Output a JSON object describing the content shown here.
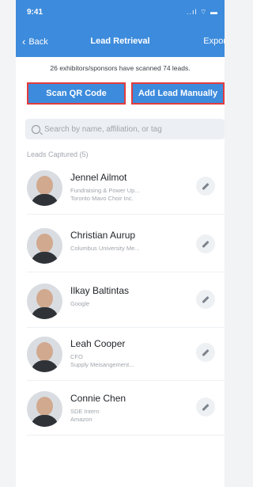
{
  "status": {
    "time": "9:41",
    "icons": "..ıl ⌔ ▬"
  },
  "header": {
    "back_label": "Back",
    "title": "Lead Retrieval",
    "export_label": "Expor"
  },
  "summary": "26 exhibitors/sponsors have scanned 74 leads.",
  "buttons": {
    "scan": "Scan QR Code",
    "add": "Add Lead Manually"
  },
  "search": {
    "placeholder": "Search by name, affiliation, or tag"
  },
  "leads_header": "Leads Captured (5)",
  "leads": [
    {
      "name": "Jennel Ailmot",
      "line1": "Fundraising & Power Up...",
      "line2": "Toronto Mavo Choir Inc."
    },
    {
      "name": "Christian Aurup",
      "line1": "Columbus University Me...",
      "line2": ""
    },
    {
      "name": "Ilkay Baltintas",
      "line1": "Google",
      "line2": ""
    },
    {
      "name": "Leah Cooper",
      "line1": "CFO",
      "line2": "Supply Meisangement..."
    },
    {
      "name": "Connie Chen",
      "line1": "SDE Intern",
      "line2": "Amazon"
    }
  ]
}
